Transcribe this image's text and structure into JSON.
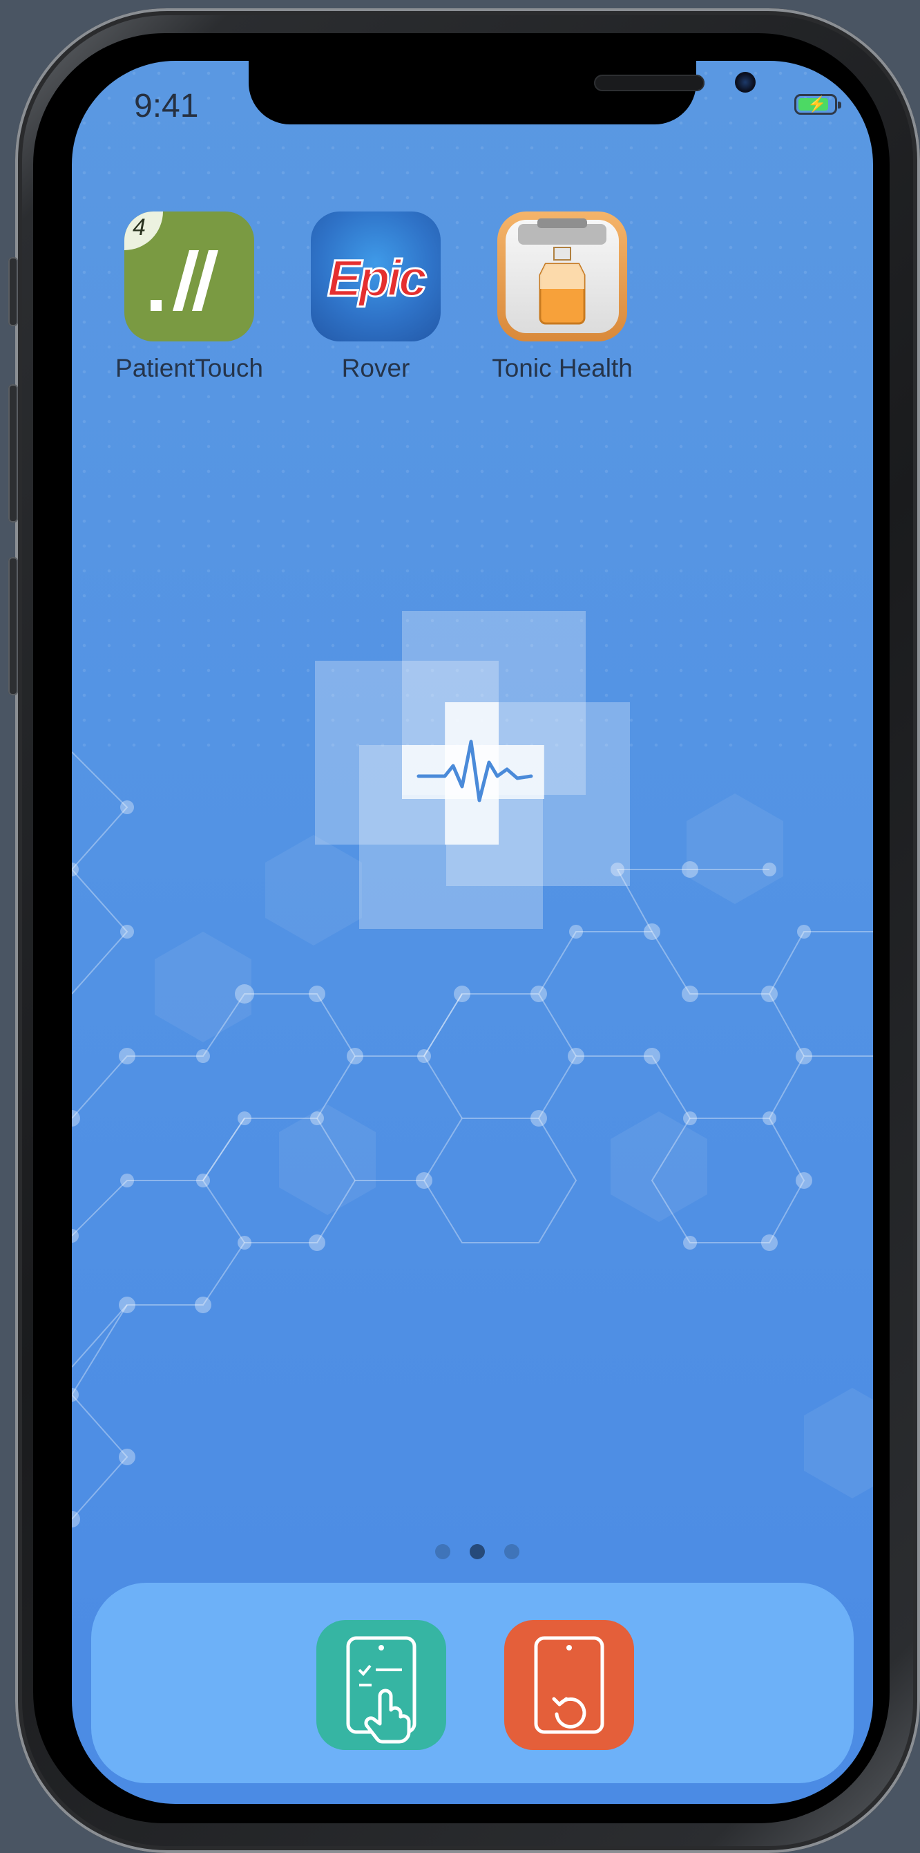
{
  "status_bar": {
    "time": "9:41",
    "battery_level": 0.85,
    "battery_charging": true,
    "battery_color": "#4cd964"
  },
  "home_apps": [
    {
      "label": "PatientTouch",
      "badge": "4",
      "icon": "patienttouch-icon",
      "color": "#7a9a42"
    },
    {
      "label": "Rover",
      "icon": "epic-rover-icon",
      "icon_text": "Epic",
      "color": "#2f73c8"
    },
    {
      "label": "Tonic Health",
      "icon": "tonic-health-icon",
      "color": "#e9a052"
    }
  ],
  "page_indicator": {
    "count": 3,
    "active_index": 1
  },
  "dock_apps": [
    {
      "icon": "checklist-touch-icon",
      "color": "#36b5a3"
    },
    {
      "icon": "device-rotate-icon",
      "color": "#e45f3a"
    }
  ],
  "wallpaper": {
    "logo_icon": "medical-cross-heartbeat-icon",
    "pattern_icon": "hexagon-network-pattern",
    "accent": "#4b8be4"
  }
}
